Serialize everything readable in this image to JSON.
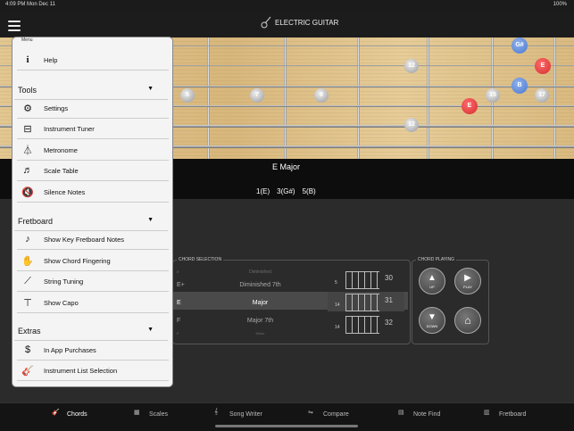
{
  "status": {
    "time": "4:09 PM  Mon Dec 11",
    "battery": "100%"
  },
  "header": {
    "title": "ELECTRIC GUITAR"
  },
  "fretboard": {
    "notes": [
      {
        "label": "G#",
        "color": "blue"
      },
      {
        "label": "E",
        "color": "red"
      },
      {
        "label": "B",
        "color": "blue"
      },
      {
        "label": "E",
        "color": "red"
      }
    ],
    "markers": [
      "5",
      "7",
      "9",
      "12",
      "12",
      "15",
      "17"
    ],
    "chord_name": "E Major",
    "intervals": [
      "1(E)",
      "3(G#)",
      "5(B)"
    ]
  },
  "chord_selection": {
    "label": "CHORD SELECTION",
    "roots": [
      "E",
      "E+",
      "E",
      "F",
      "F"
    ],
    "types": [
      "Diminished",
      "Diminished 7th",
      "Major",
      "Major 7th",
      "Minor"
    ],
    "selected_type": "Major",
    "diagram_numbers": [
      "30",
      "31",
      "32"
    ],
    "diagram_frets": [
      "5",
      "14",
      "14"
    ]
  },
  "chord_playing": {
    "label": "CHORD PLAYING",
    "up": "UP",
    "play": "PLAY",
    "down": "DOWN"
  },
  "menu": {
    "header": "Menu",
    "help": "Help",
    "tools": {
      "title": "Tools",
      "items": [
        "Settings",
        "Instrument Tuner",
        "Metronome",
        "Scale Table",
        "Silence Notes"
      ]
    },
    "fretboard": {
      "title": "Fretboard",
      "items": [
        "Show Key Fretboard Notes",
        "Show Chord Fingering",
        "String Tuning",
        "Show Capo"
      ]
    },
    "extras": {
      "title": "Extras",
      "items": [
        "In App Purchases",
        "Instrument List Selection"
      ]
    }
  },
  "tabs": [
    "Chords",
    "Scales",
    "Song Writer",
    "Compare",
    "Note Find",
    "Fretboard"
  ]
}
